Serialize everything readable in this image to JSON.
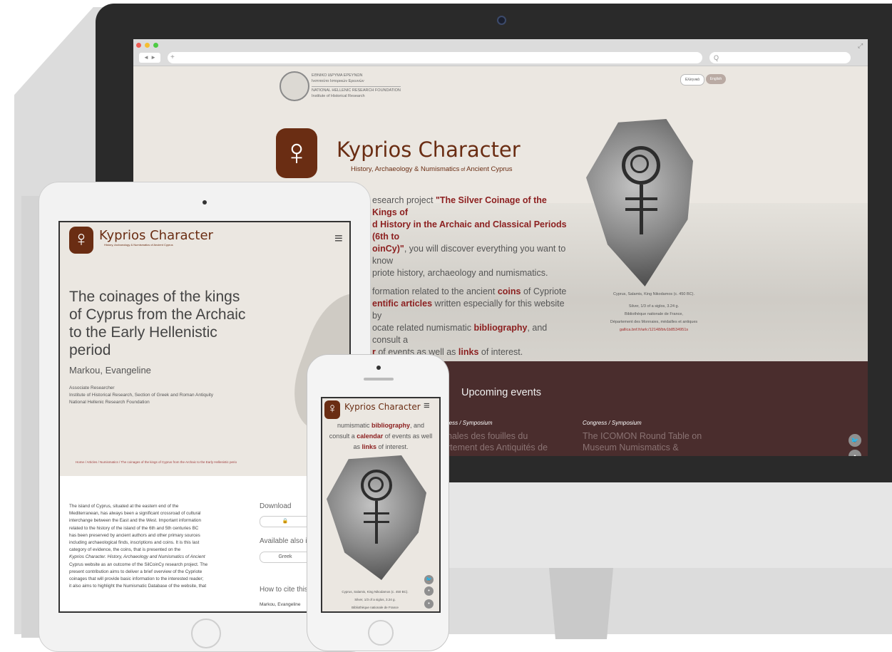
{
  "desktop": {
    "browser": {
      "url_placeholder": "+",
      "search_placeholder": "Q",
      "nav": "◄ ►"
    },
    "institution": {
      "line1": "ΕΘΝΙΚΟ ΙΔΡΥΜΑ ΕΡΕΥΝΩΝ",
      "line2": "Ινστιτούτο Ιστορικών Ερευνών",
      "line3": "NATIONAL HELLENIC RESEARCH FOUNDATION",
      "line4": "Institute of Historical Research"
    },
    "lang_greek": "Ελληνικά",
    "lang_english": "English",
    "brand": {
      "title": "Kyprios Character",
      "subtitle_main": "History, Archaeology & Numismatics",
      "subtitle_of": " of ",
      "subtitle_end": "Ancient Cyprus"
    },
    "intro": {
      "p1_a": "esearch project ",
      "p1_b": "\"The Silver Coinage of the Kings of",
      "p1_c": "d History in the Archaic and Classical Periods (6th to",
      "p1_d": "oinCy)\"",
      "p1_e": ", you will discover everything you want to know",
      "p1_f": "priote history, archaeology and numismatics.",
      "p2_a": "formation related to the ancient ",
      "p2_b": "coins",
      "p2_c": " of Cypriote",
      "p2_d": "entific articles",
      "p2_e": " written especially for this website by",
      "p2_f": "ocate related numismatic ",
      "p2_g": "bibliography",
      "p2_h": ", and consult a",
      "p2_i": "r",
      "p2_j": " of events as well as ",
      "p2_k": "links",
      "p2_l": " of interest."
    },
    "coin_caption": {
      "l1": "Cyprus, Salamis, King Nikodamos (c. 450 BC).",
      "l2": "Silver, 1/3 of a siglos, 3.24 g.",
      "l3": "Bibliothèque nationale de France,",
      "l4": "Département des Monnaies, médailles et antiques",
      "l5": "gallica.bnf.fr/ark:/12148/btv1b8534951s"
    },
    "events": {
      "title": "Upcoming events",
      "items": [
        {
          "label": "ress / Symposium",
          "name_l1": "nales des fouilles du",
          "name_l2": "rtement des Antiquités de"
        },
        {
          "label": "Congress / Symposium",
          "name_l1": "The ICOMON Round Table on",
          "name_l2": "Museum Numismatics &"
        }
      ]
    },
    "social": {
      "twitter": "🐦",
      "other": "•"
    }
  },
  "tablet": {
    "brand_title": "Kyprios Character",
    "brand_sub": "History, Archaeology & Numismatics of Ancient Cyprus",
    "menu_icon": "≡",
    "article_title_l1": "The coinages of the kings",
    "article_title_l2": "of Cyprus from the Archaic",
    "article_title_l3": "to the Early Hellenistic",
    "article_title_l4": "period",
    "author": "Markou, Evangeline",
    "affil_l1": "Associate Researcher",
    "affil_l2": "Institute of Historical Research, Section of Greek and Roman Antiquity",
    "affil_l3": "National Hellenic Research Foundation",
    "breadcrumb": "Home  /  Articles  /  Numismatics  /  The coinages of the kings of Cyprus from the Archaic to the Early Hellenistic perio",
    "body": [
      "The island of Cyprus, situated at the eastern end of the",
      "Mediterranean, has always been a significant crossroad of cultural",
      "interchange between the East and the West. Important information",
      "related to the history of the island of the 6th and 5th centuries BC",
      "has been preserved by ancient authors and other primary sources",
      "including archaeological finds, inscriptions and coins. It is this last",
      "category of evidence, the coins, that is presented on the",
      "Kyprios Character. History, Archaeology and Numismatics of Ancient",
      "Cyprus website as an outcome of the SilCoinCy research project. The",
      "present contribution aims to deliver a brief overview of the Cypriote",
      "coinages that will provide basic information to the interested reader;",
      "it also aims to highlight the Numismatic Database of the website, that"
    ],
    "download_label": "Download",
    "download_icon": "🔒",
    "available_label": "Available also in",
    "lang_button": "Greek",
    "cite_label": "How to cite this",
    "cite_author": "Markou, Evangeline"
  },
  "phone": {
    "brand_title": "Kyprios Character",
    "menu_icon": "≡",
    "text_l1_a": "numismatic ",
    "text_l1_b": "bibliography",
    "text_l1_c": ", and",
    "text_l2_a": "consult a ",
    "text_l2_b": "calendar",
    "text_l2_c": " of events as well",
    "text_l3_a": "as ",
    "text_l3_b": "links",
    "text_l3_c": " of interest.",
    "caption_l1": "Cyprus, Salamis, King Nikodamos (c. 450 BC).",
    "caption_l2": "Silver, 1/3 of a siglos, 3.24 g.",
    "caption_l3": "Bibliothèque nationale de France"
  },
  "colors": {
    "brand": "#6a2d13",
    "link": "#8c2020",
    "events_bg": "#4a2d2d"
  }
}
